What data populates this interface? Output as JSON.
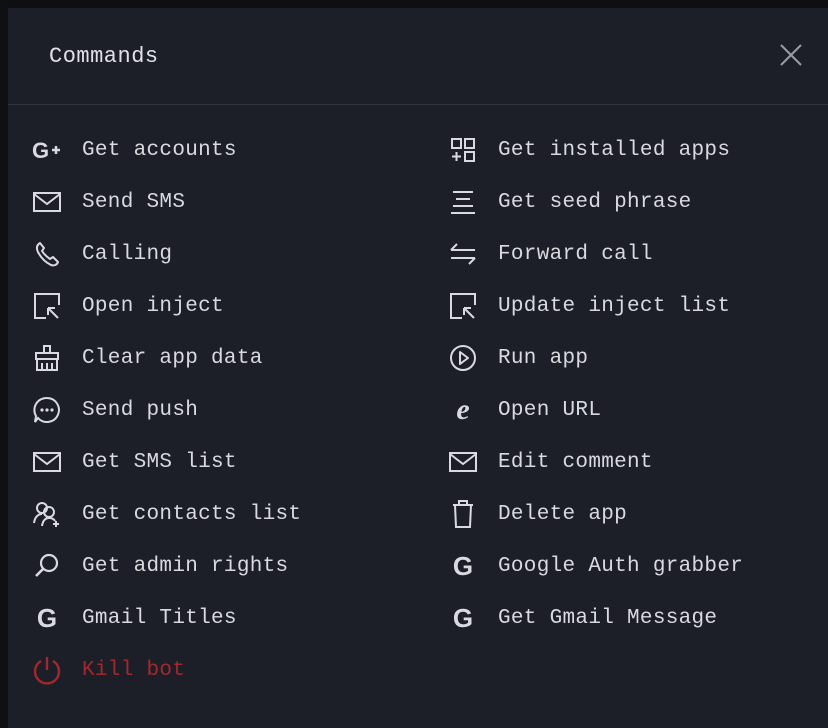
{
  "dialog": {
    "title": "Commands",
    "close_label": "Close"
  },
  "colors": {
    "background": "#1c1f28",
    "text": "#d8dadf",
    "danger": "#a3282c",
    "divider": "#2f333d"
  },
  "commands": {
    "left": [
      {
        "label": "Get accounts",
        "icon": "google-plus-icon"
      },
      {
        "label": "Send SMS",
        "icon": "envelope-icon"
      },
      {
        "label": "Calling",
        "icon": "phone-icon"
      },
      {
        "label": "Open inject",
        "icon": "select-arrow-icon"
      },
      {
        "label": "Clear app data",
        "icon": "broom-icon"
      },
      {
        "label": "Send push",
        "icon": "chat-bubble-icon"
      },
      {
        "label": "Get SMS list",
        "icon": "envelope-icon"
      },
      {
        "label": "Get contacts list",
        "icon": "contacts-icon"
      },
      {
        "label": "Get admin rights",
        "icon": "magnifier-icon"
      },
      {
        "label": "Gmail Titles",
        "icon": "google-icon"
      },
      {
        "label": "Kill bot",
        "icon": "power-icon"
      }
    ],
    "right": [
      {
        "label": "Get installed apps",
        "icon": "apps-grid-icon"
      },
      {
        "label": "Get seed phrase",
        "icon": "align-center-icon"
      },
      {
        "label": "Forward call",
        "icon": "swap-arrows-icon"
      },
      {
        "label": "Update inject list",
        "icon": "select-arrow-icon"
      },
      {
        "label": "Run app",
        "icon": "play-circle-icon"
      },
      {
        "label": "Open URL",
        "icon": "internet-explorer-icon"
      },
      {
        "label": "Edit comment",
        "icon": "envelope-icon"
      },
      {
        "label": "Delete app",
        "icon": "trash-icon"
      },
      {
        "label": "Google Auth grabber",
        "icon": "google-icon"
      },
      {
        "label": "Get Gmail Message",
        "icon": "google-icon"
      }
    ]
  }
}
